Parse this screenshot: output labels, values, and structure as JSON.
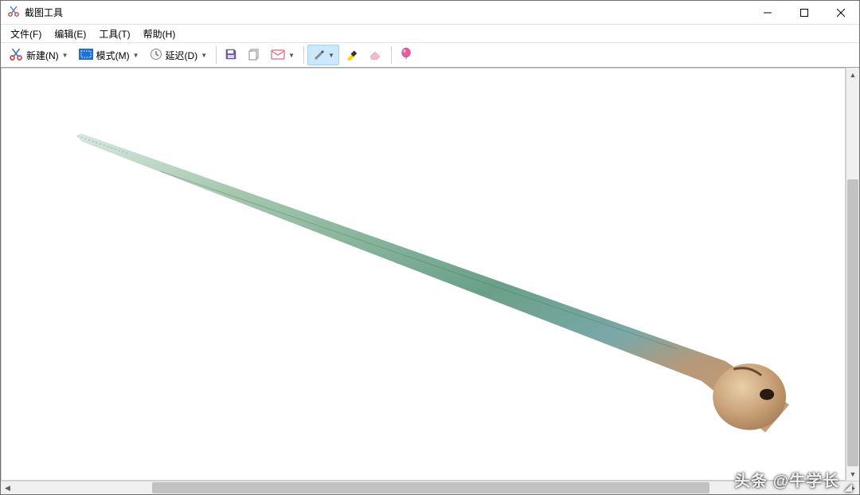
{
  "window": {
    "title": "截图工具"
  },
  "menu": {
    "file": "文件(F)",
    "edit": "编辑(E)",
    "tools": "工具(T)",
    "help": "帮助(H)"
  },
  "toolbar": {
    "new_label": "新建(N)",
    "mode_label": "模式(M)",
    "delay_label": "延迟(D)"
  },
  "watermark": {
    "prefix": "头条",
    "handle": "@牛学长",
    "corner": "◢"
  }
}
